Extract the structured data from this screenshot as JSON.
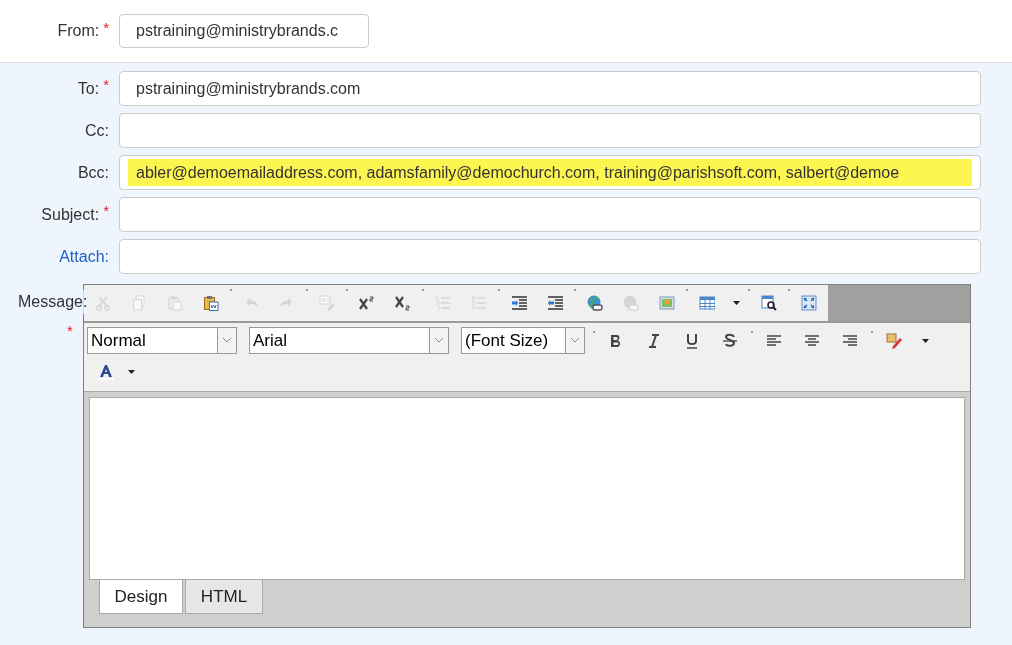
{
  "from": {
    "label": "From:",
    "required_marker": "*",
    "value": "pstraining@ministrybrands.c"
  },
  "fields": [
    {
      "label": "To:",
      "required_marker": "*",
      "is_link": false,
      "highlighted": false,
      "value": "pstraining@ministrybrands.com"
    },
    {
      "label": "Cc:",
      "is_link": false,
      "highlighted": false
    },
    {
      "label": "Bcc:",
      "is_link": false,
      "highlighted": true,
      "value": "abler@demoemailaddress.com, adamsfamily@demochurch.com, training@parishsoft.com, salbert@demoe"
    },
    {
      "label": "Subject:",
      "required_marker": "*",
      "is_link": false,
      "highlighted": false
    },
    {
      "label": "Attach:",
      "is_link": true,
      "highlighted": false
    }
  ],
  "message": {
    "label": "Message:",
    "required_marker": "*",
    "toolbar_row_1": [
      {
        "kind": "cut",
        "disabled": true,
        "separator_before": false,
        "has_dropdown": false
      },
      {
        "kind": "copy",
        "disabled": true,
        "separator_before": false,
        "has_dropdown": false
      },
      {
        "kind": "paste",
        "disabled": true,
        "separator_before": false,
        "has_dropdown": false
      },
      {
        "kind": "paste-word",
        "disabled": false,
        "separator_before": false,
        "has_dropdown": false
      },
      {
        "kind": "undo",
        "disabled": true,
        "separator_before": true,
        "has_dropdown": false
      },
      {
        "kind": "redo",
        "disabled": true,
        "separator_before": false,
        "has_dropdown": false
      },
      {
        "kind": "spellcheck",
        "disabled": true,
        "separator_before": true,
        "has_dropdown": false
      },
      {
        "kind": "superscript",
        "disabled": false,
        "separator_before": true,
        "has_dropdown": false
      },
      {
        "kind": "subscript",
        "disabled": false,
        "separator_before": false,
        "has_dropdown": false
      },
      {
        "kind": "numbered-list",
        "disabled": true,
        "separator_before": true,
        "has_dropdown": false
      },
      {
        "kind": "bulleted-list",
        "disabled": true,
        "separator_before": false,
        "has_dropdown": false
      },
      {
        "kind": "indent",
        "disabled": false,
        "separator_before": true,
        "has_dropdown": false
      },
      {
        "kind": "outdent",
        "disabled": false,
        "separator_before": false,
        "has_dropdown": false
      },
      {
        "kind": "link",
        "disabled": false,
        "separator_before": true,
        "has_dropdown": false
      },
      {
        "kind": "unlink",
        "disabled": true,
        "separator_before": false,
        "has_dropdown": false
      },
      {
        "kind": "image",
        "disabled": false,
        "separator_before": false,
        "has_dropdown": false
      },
      {
        "kind": "table",
        "disabled": false,
        "separator_before": true,
        "has_dropdown": true
      },
      {
        "kind": "preview",
        "disabled": false,
        "separator_before": true,
        "has_dropdown": false
      },
      {
        "kind": "maximize",
        "disabled": false,
        "separator_before": true,
        "has_dropdown": false
      }
    ],
    "format_selects": [
      {
        "value": "Normal"
      },
      {
        "value": "Arial"
      },
      {
        "value": "(Font Size)"
      }
    ],
    "toolbar_row_2": [
      {
        "kind": "bold",
        "disabled": false,
        "separator_before": true,
        "has_dropdown": false
      },
      {
        "kind": "italic",
        "disabled": false,
        "separator_before": false,
        "has_dropdown": false
      },
      {
        "kind": "underline",
        "disabled": false,
        "separator_before": false,
        "has_dropdown": false
      },
      {
        "kind": "strike",
        "disabled": false,
        "separator_before": false,
        "has_dropdown": false
      },
      {
        "kind": "align-left",
        "disabled": false,
        "separator_before": true,
        "has_dropdown": false
      },
      {
        "kind": "align-center",
        "disabled": false,
        "separator_before": false,
        "has_dropdown": false
      },
      {
        "kind": "align-right",
        "disabled": false,
        "separator_before": false,
        "has_dropdown": false
      },
      {
        "kind": "highlight",
        "disabled": false,
        "separator_before": true,
        "has_dropdown": true
      }
    ],
    "toolbar_row_3": [
      {
        "kind": "font-color",
        "disabled": false,
        "separator_before": false,
        "has_dropdown": true
      }
    ],
    "tabs": [
      {
        "label": "Design",
        "selected": true
      },
      {
        "label": "HTML",
        "selected": false
      }
    ]
  }
}
